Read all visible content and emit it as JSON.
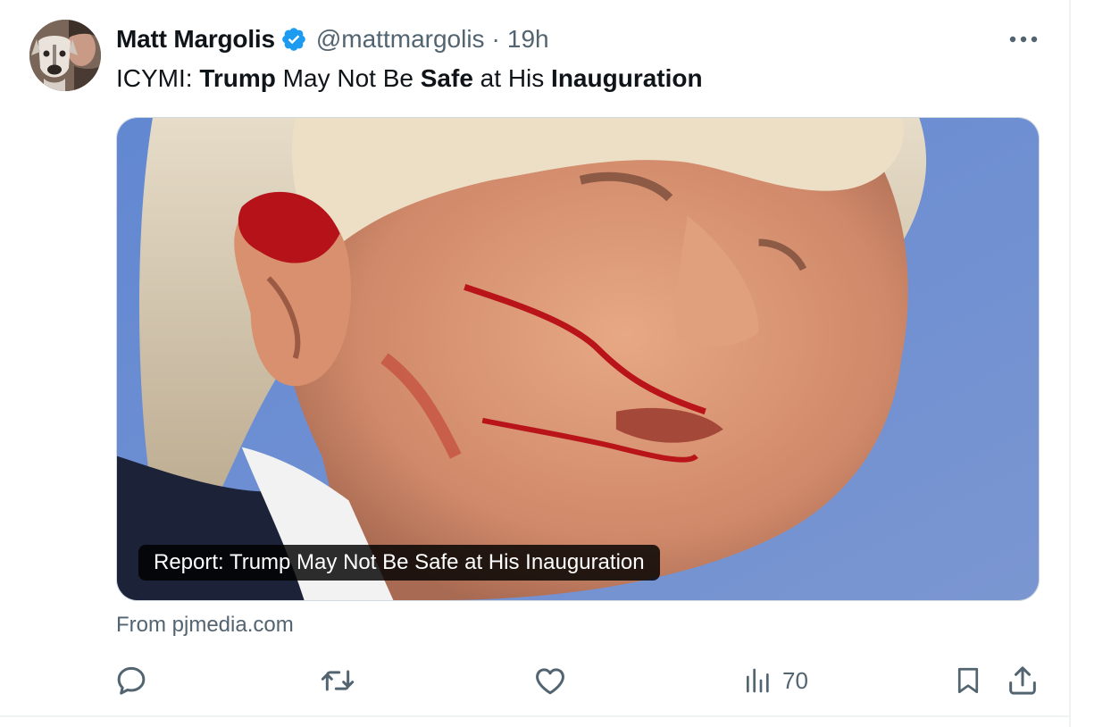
{
  "post": {
    "author": {
      "display_name": "Matt Margolis",
      "verified": true,
      "handle": "@mattmargolis",
      "separator": "·",
      "time": "19h"
    },
    "text": {
      "prefix": "ICYMI: ",
      "w1": "Trump",
      "t2": " May Not Be ",
      "w2": "Safe",
      "t3": " at His ",
      "w3": "Inauguration"
    },
    "card": {
      "caption": "Report: Trump May Not Be Safe at His Inauguration",
      "source": "From pjmedia.com"
    },
    "stats": {
      "views": "70"
    }
  },
  "colors": {
    "verified_badge": "#1d9bf0",
    "secondary_text": "#536471",
    "icon": "#536471",
    "divider": "#eff3f4",
    "card_sky": "#6f8ecf"
  },
  "icons": {
    "more": "more-horizontal-icon",
    "reply": "reply-icon",
    "retweet": "retweet-icon",
    "like": "heart-icon",
    "views": "views-bar-chart-icon",
    "bookmark": "bookmark-icon",
    "share": "share-icon"
  }
}
